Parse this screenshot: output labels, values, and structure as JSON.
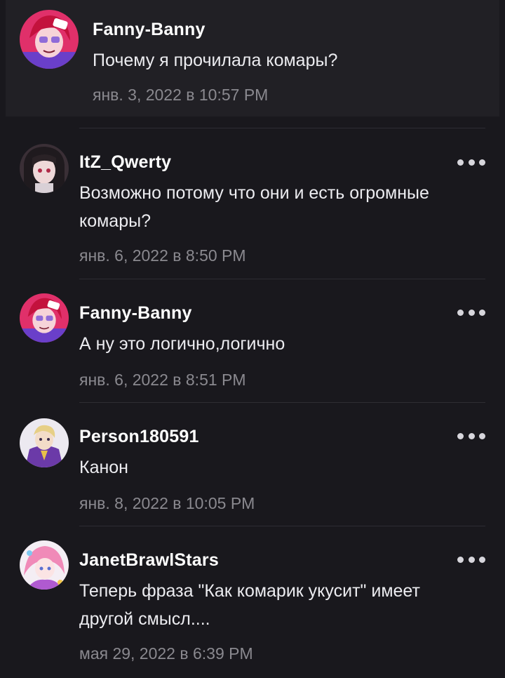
{
  "comments": [
    {
      "author": "Fanny-Banny",
      "text": "Почему я прочилала комары?",
      "timestamp": "янв. 3, 2022 в 10:57 PM",
      "avatar_icon": "anime-girl-red-hair-avatar"
    },
    {
      "author": "ItZ_Qwerty",
      "text": "Возможно потому что они и есть огромные комары?",
      "timestamp": "янв. 6, 2022 в 8:50 PM",
      "avatar_icon": "anime-girl-dark-hair-avatar"
    },
    {
      "author": "Fanny-Banny",
      "text": "А ну это логично,логично",
      "timestamp": "янв. 6, 2022 в 8:51 PM",
      "avatar_icon": "anime-girl-red-hair-avatar"
    },
    {
      "author": "Person180591",
      "text": "Канон",
      "timestamp": "янв. 8, 2022 в 10:05 PM",
      "avatar_icon": "anime-character-purple-suit-avatar"
    },
    {
      "author": "JanetBrawlStars",
      "text": "Теперь фраза \"Как комарик укусит\" имеет другой смысл....",
      "timestamp": "мая 29, 2022 в 6:39 PM",
      "avatar_icon": "anime-girl-pink-hair-avatar"
    }
  ],
  "colors": {
    "background": "#19181d",
    "root_background": "#212025",
    "text": "#ececf0",
    "timestamp": "#8a898f",
    "accent_purple": "#6a3fc9"
  }
}
